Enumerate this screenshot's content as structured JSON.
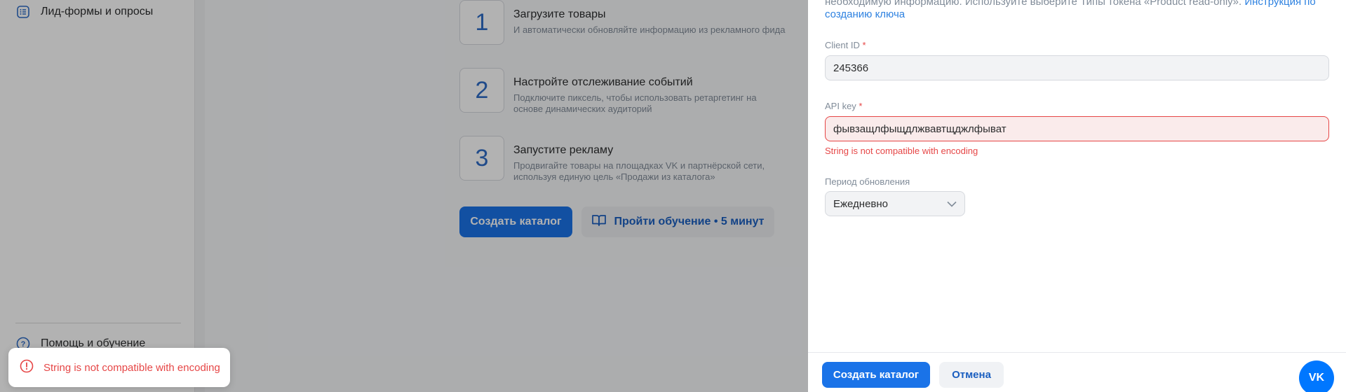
{
  "sidebar": {
    "items": [
      {
        "label": "Лид-формы и опросы",
        "icon": "list-icon"
      },
      {
        "label": "Помощь и обучение",
        "icon": "question-icon"
      }
    ]
  },
  "main": {
    "steps": [
      {
        "number": "1",
        "title": "Загрузите товары",
        "description": "И автоматически обновляйте информацию из рекламного фида"
      },
      {
        "number": "2",
        "title": "Настройте отслеживание событий",
        "description": "Подключите пиксель, чтобы использовать ретаргетинг на основе динамических аудиторий"
      },
      {
        "number": "3",
        "title": "Запустите рекламу",
        "description": "Продвигайте товары на площадках VK и партнёрской сети, используя единую цель «Продажи из каталога»"
      }
    ],
    "create_button": "Создать каталог",
    "tutorial_button": "Пройти обучение • 5 минут"
  },
  "toast": {
    "message": "String is not compatible with encoding",
    "icon": "error-circle-icon"
  },
  "drawer": {
    "intro_text": "необходимую информацию. Используйте выберите Типы токена «Product read-only».",
    "intro_link": "Инструкция по созданию ключа",
    "client_id": {
      "label": "Client ID",
      "required": "*",
      "value": "245366"
    },
    "api_key": {
      "label": "API key",
      "required": "*",
      "value": "фывзащлфыщдлжвавтщджлфыват",
      "error": "String is not compatible with encoding"
    },
    "period": {
      "label": "Период обновления",
      "value": "Ежедневно"
    },
    "footer": {
      "submit": "Создать каталог",
      "cancel": "Отмена",
      "vk_label": "VK"
    }
  },
  "colors": {
    "accent": "#1a73e8",
    "error": "#e64646",
    "link": "#2d81e0"
  }
}
